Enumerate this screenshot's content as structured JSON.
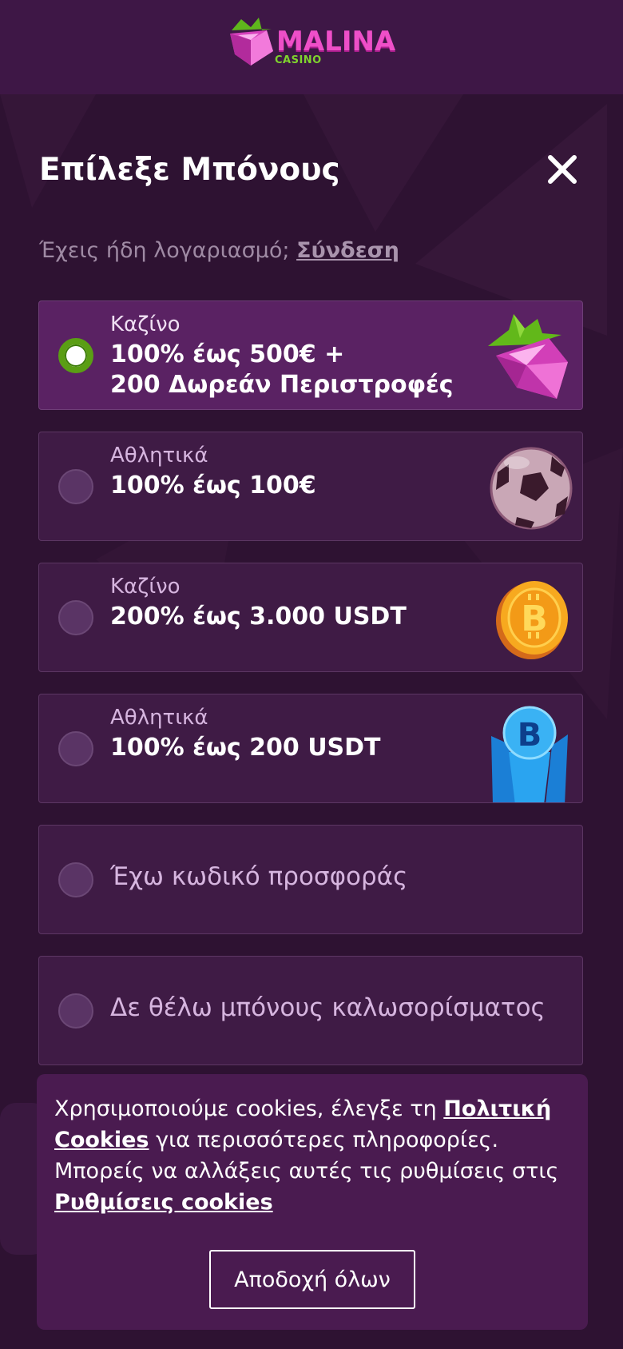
{
  "brand": {
    "name": "MALINA",
    "sub": "CASINO"
  },
  "modal": {
    "title": "Επίλεξε Μπόνους",
    "login_prompt": "Έχεις ήδη λογαριασμό;",
    "login_link": "Σύνδεση"
  },
  "bonuses": [
    {
      "category": "Καζίνο",
      "line1": "100% έως 500€ +",
      "line2": "200 Δωρεάν Περιστροφές",
      "selected": true,
      "icon": "raspberry-gem-icon"
    },
    {
      "category": "Αθλητικά",
      "line1": "100% έως 100€",
      "selected": false,
      "icon": "soccer-ball-icon"
    },
    {
      "category": "Καζίνο",
      "line1": "200% έως 3.000 USDT",
      "selected": false,
      "icon": "bitcoin-coin-icon"
    },
    {
      "category": "Αθλητικά",
      "line1": "100% έως 200 USDT",
      "selected": false,
      "icon": "bitcoin-crystal-icon"
    }
  ],
  "promo_option": "Έχω κωδικό προσφοράς",
  "no_bonus_option": "Δε θέλω μπόνους καλωσορίσματος",
  "cookie": {
    "text1": "Χρησιμοποιούμε cookies, έλεγξε τη ",
    "link1": "Πολιτική Cookies",
    "text2": " για περισσότερες πληροφορίες. Μπορείς να αλλάξεις αυτές τις ρυθμίσεις στις ",
    "link2": "Ρυθμίσεις cookies",
    "accept": "Αποδοχή όλων"
  },
  "colors": {
    "background": "#2e1232",
    "card": "#3f1b45",
    "card_selected": "#5a2263",
    "radio_on": "#5a9e14",
    "brand_pink": "#ee4fc8",
    "brand_green": "#7fd32e"
  }
}
